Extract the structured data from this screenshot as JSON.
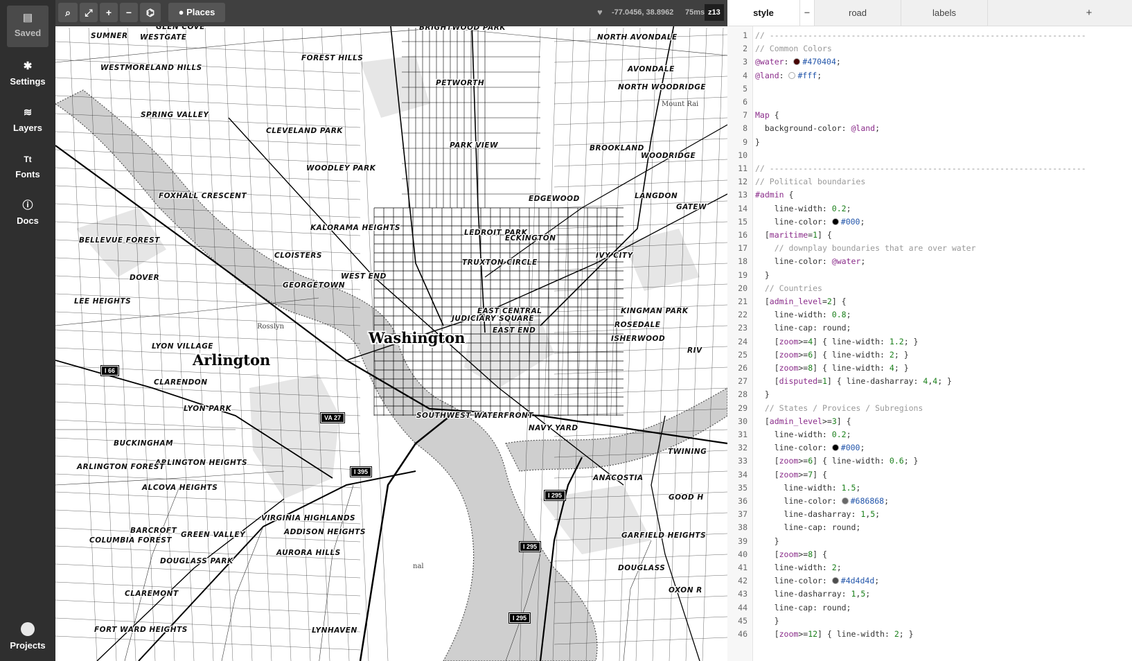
{
  "sidebar": {
    "saved": {
      "label": "Saved",
      "icon": "file-icon"
    },
    "items": [
      {
        "label": "Settings",
        "icon": "gear-icon",
        "glyph": "✱"
      },
      {
        "label": "Layers",
        "icon": "layers-icon",
        "glyph": "≋"
      },
      {
        "label": "Fonts",
        "icon": "fonts-icon",
        "glyph": "Tt"
      },
      {
        "label": "Docs",
        "icon": "info-icon",
        "glyph": "ⓘ"
      }
    ],
    "projects": {
      "label": "Projects",
      "icon": "avatar-icon"
    }
  },
  "toolbar": {
    "search_glyph": "⌕",
    "fullscreen_glyph": "⤢",
    "zoom_in_glyph": "+",
    "zoom_out_glyph": "−",
    "inspect_glyph": "⌬",
    "places_label": "Places",
    "heart_glyph": "♥",
    "coordinates": "-77.0456, 38.8962",
    "render_time": "75ms",
    "zoom": "z13"
  },
  "map": {
    "labels": [
      "SUMNER",
      "GLEN COVE",
      "WESTGATE",
      "BRIGHTWOOD PARK",
      "NORTH AVONDALE",
      "FOREST HILLS",
      "WESTMORELAND HILLS",
      "AVONDALE",
      "PETWORTH",
      "NORTH WOODRIDGE",
      "SPRING VALLEY",
      "CLEVELAND PARK",
      "PARK VIEW",
      "BROOKLAND",
      "WOODRIDGE",
      "WOODLEY PARK",
      "FOXHALL CRESCENT",
      "EDGEWOOD",
      "LANGDON",
      "KALORAMA HEIGHTS",
      "LEDROIT PARK",
      "ECKINGTON",
      "BELLEVUE FOREST",
      "CLOISTERS",
      "TRUXTON CIRCLE",
      "IVY CITY",
      "DOVER",
      "WEST END",
      "GEORGETOWN",
      "LEE HEIGHTS",
      "EAST CENTRAL",
      "JUDICIARY SQUARE",
      "KINGMAN PARK",
      "ROSEDALE",
      "EAST END",
      "LYON VILLAGE",
      "ISHERWOOD",
      "CLARENDON",
      "LYON PARK",
      "SOUTHWEST WATERFRONT",
      "NAVY YARD",
      "BUCKINGHAM",
      "ARLINGTON HEIGHTS",
      "ARLINGTON FOREST",
      "ANACOSTIA",
      "TWINING",
      "ALCOVA HEIGHTS",
      "GOOD H",
      "BARCROFT",
      "VIRGINIA HIGHLANDS",
      "GREEN VALLEY",
      "ADDISON HEIGHTS",
      "COLUMBIA FOREST",
      "GARFIELD HEIGHTS",
      "AURORA HILLS",
      "DOUGLASS PARK",
      "DOUGLASS",
      "CLAREMONT",
      "OXON R",
      "FORT WARD HEIGHTS",
      "LYNHAVEN",
      "GATEW",
      "RIV"
    ],
    "cities": [
      "Washington",
      "Arlington"
    ],
    "small_places": [
      "Rosslyn",
      "Mount Rai",
      "nal"
    ],
    "shields": [
      "I 66",
      "VA 27",
      "I 395",
      "I 295",
      "I 295",
      "I 295"
    ]
  },
  "editor": {
    "tabs": [
      {
        "label": "style",
        "active": true
      },
      {
        "label": "road",
        "active": false
      },
      {
        "label": "labels",
        "active": false
      }
    ],
    "tab_close_glyph": "−",
    "add_tab_glyph": "+",
    "lines": [
      "// ------------------------------------------------------------------",
      "// Common Colors",
      "@water: #470404;",
      "@land: #fff;",
      "",
      "",
      "Map {",
      "  background-color: @land;",
      "}",
      "",
      "// ------------------------------------------------------------------",
      "// Political boundaries",
      "#admin {",
      "    line-width: 0.2;",
      "    line-color: #000;",
      "  [maritime=1] {",
      "    // downplay boundaries that are over water",
      "    line-color: @water;",
      "  }",
      "  // Countries",
      "  [admin_level=2] {",
      "    line-width: 0.8;",
      "    line-cap: round;",
      "    [zoom>=4] { line-width: 1.2; }",
      "    [zoom>=6] { line-width: 2; }",
      "    [zoom>=8] { line-width: 4; }",
      "    [disputed=1] { line-dasharray: 4,4; }",
      "  }",
      "  // States / Provices / Subregions",
      "  [admin_level>=3] {",
      "    line-width: 0.2;",
      "    line-color: #000;",
      "    [zoom>=6] { line-width: 0.6; }",
      "    [zoom>=7] {",
      "      line-width: 1.5;",
      "      line-color: #686868;",
      "      line-dasharray: 1,5;",
      "      line-cap: round;",
      "    }",
      "    [zoom>=8] {",
      "    line-width: 2;",
      "    line-color: #4d4d4d;",
      "    line-dasharray: 1,5;",
      "    line-cap: round;",
      "    }",
      "    [zoom>=12] { line-width: 2; }"
    ]
  }
}
